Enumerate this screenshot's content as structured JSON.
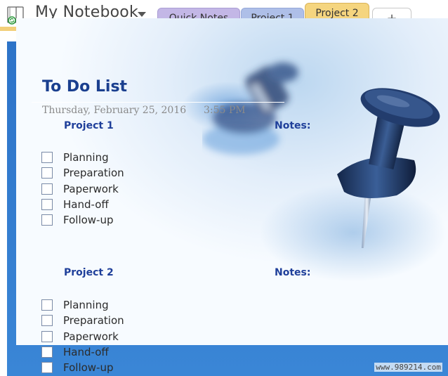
{
  "notebook": {
    "title": "My Notebook"
  },
  "tabs": [
    {
      "label": "Quick Notes",
      "color": "#c3b7e6"
    },
    {
      "label": "Project 1",
      "color": "#aebfe8"
    },
    {
      "label": "Project 2",
      "color": "#f5d57f",
      "active": true
    },
    {
      "label": "+"
    }
  ],
  "page": {
    "title": "To Do List",
    "date": "Thursday, February 25, 2016",
    "time": "3:55 PM",
    "sections": [
      {
        "heading": "Project 1",
        "notes_label": "Notes:",
        "tasks": [
          "Planning",
          "Preparation",
          "Paperwork",
          "Hand-off",
          "Follow-up"
        ]
      },
      {
        "heading": "Project 2",
        "notes_label": "Notes:",
        "tasks": [
          "Planning",
          "Preparation",
          "Paperwork",
          "Hand-off",
          "Follow-up"
        ]
      }
    ]
  },
  "watermark": "www.989214.com"
}
